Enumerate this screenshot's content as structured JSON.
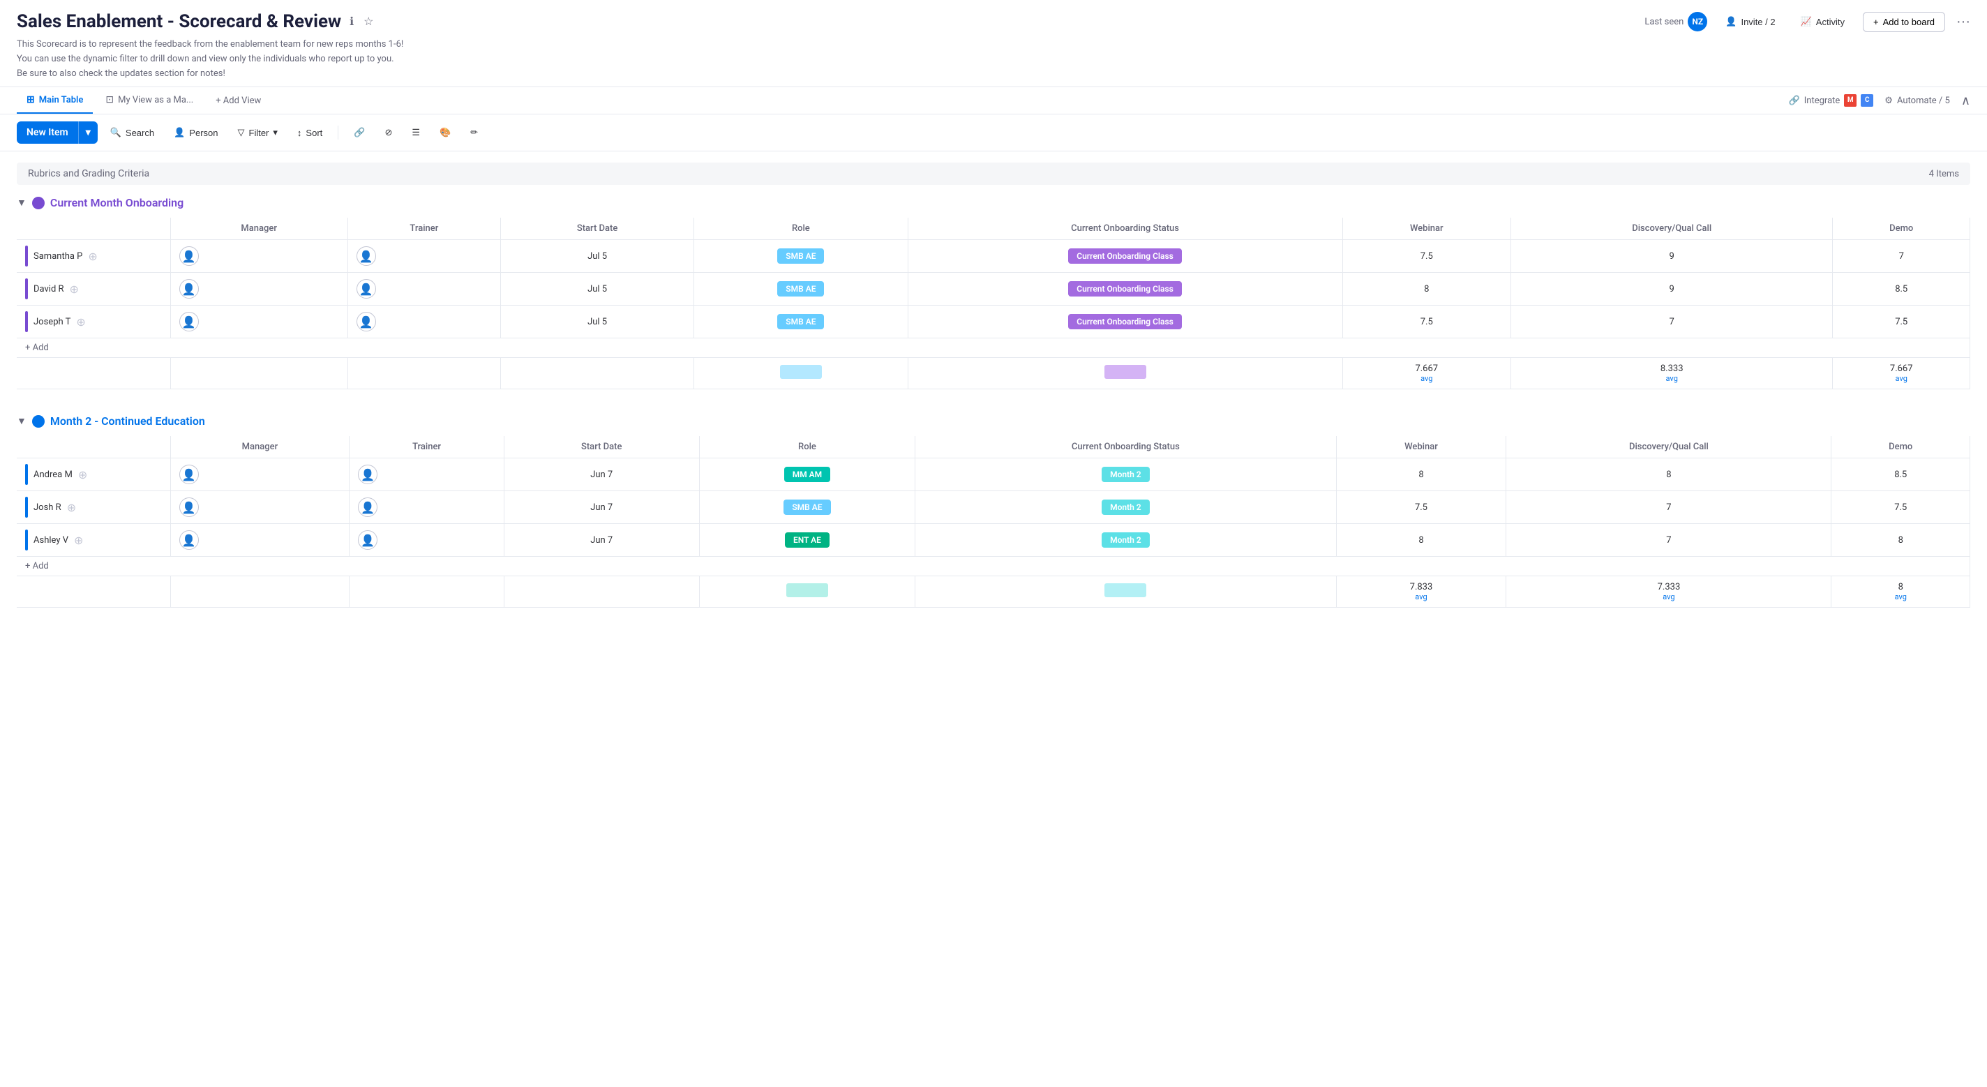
{
  "header": {
    "title": "Sales Enablement - Scorecard & Review",
    "subtitle_line1": "This Scorecard is to represent the feedback from the enablement team for new reps months 1-6!",
    "subtitle_line2": "You can use the dynamic filter to drill down and view only the individuals who report up to you.",
    "subtitle_line3": "Be sure to also check the updates section for notes!",
    "last_seen_label": "Last seen",
    "avatar_initials": "NZ",
    "invite_label": "Invite / 2",
    "activity_label": "Activity",
    "add_board_label": "+ Add to board",
    "more_icon": "···"
  },
  "tabs": {
    "items": [
      {
        "label": "Main Table",
        "icon": "⊞",
        "active": true
      },
      {
        "label": "My View as a Ma...",
        "icon": "⊡",
        "active": false
      }
    ],
    "add_label": "+ Add View",
    "integrate_label": "Integrate",
    "automate_label": "Automate / 5"
  },
  "toolbar": {
    "new_item_label": "New Item",
    "search_label": "Search",
    "person_label": "Person",
    "filter_label": "Filter",
    "sort_label": "Sort"
  },
  "rubrics": {
    "label": "Rubrics and Grading Criteria",
    "count": "4 Items"
  },
  "group1": {
    "name": "Current Month Onboarding",
    "color": "purple",
    "columns": [
      "Manager",
      "Trainer",
      "Start Date",
      "Role",
      "Current Onboarding Status",
      "Webinar",
      "Discovery/Qual Call",
      "Demo"
    ],
    "rows": [
      {
        "name": "Samantha P",
        "start_date": "Jul 5",
        "role": "SMB AE",
        "role_color": "cyan",
        "status": "Current Onboarding Class",
        "status_color": "purple",
        "webinar": "7.5",
        "discovery": "9",
        "demo": "7"
      },
      {
        "name": "David R",
        "start_date": "Jul 5",
        "role": "SMB AE",
        "role_color": "cyan",
        "status": "Current Onboarding Class",
        "status_color": "purple",
        "webinar": "8",
        "discovery": "9",
        "demo": "8.5"
      },
      {
        "name": "Joseph T",
        "start_date": "Jul 5",
        "role": "SMB AE",
        "role_color": "cyan",
        "status": "Current Onboarding Class",
        "status_color": "purple",
        "webinar": "7.5",
        "discovery": "7",
        "demo": "7.5"
      }
    ],
    "avg": {
      "webinar": "7.667",
      "discovery": "8.333",
      "demo": "7.667"
    },
    "avg_label": "avg",
    "role_avg_color": "cyan",
    "status_avg_color": "purple"
  },
  "group2": {
    "name": "Month 2 - Continued Education",
    "color": "blue",
    "columns": [
      "Manager",
      "Trainer",
      "Start Date",
      "Role",
      "Current Onboarding Status",
      "Webinar",
      "Discovery/Qual Call",
      "Demo"
    ],
    "rows": [
      {
        "name": "Andrea M",
        "start_date": "Jun 7",
        "role": "MM AM",
        "role_color": "teal",
        "status": "Month 2",
        "status_color": "blue",
        "webinar": "8",
        "discovery": "8",
        "demo": "8.5"
      },
      {
        "name": "Josh R",
        "start_date": "Jun 7",
        "role": "SMB AE",
        "role_color": "cyan",
        "status": "Month 2",
        "status_color": "blue",
        "webinar": "7.5",
        "discovery": "7",
        "demo": "7.5"
      },
      {
        "name": "Ashley V",
        "start_date": "Jun 7",
        "role": "ENT AE",
        "role_color": "green",
        "status": "Month 2",
        "status_color": "blue",
        "webinar": "8",
        "discovery": "7",
        "demo": "8"
      }
    ],
    "avg": {
      "webinar": "7.833",
      "discovery": "7.333",
      "demo": "8"
    },
    "avg_label": "avg",
    "role_avg_color": "teal",
    "status_avg_color": "blue"
  }
}
